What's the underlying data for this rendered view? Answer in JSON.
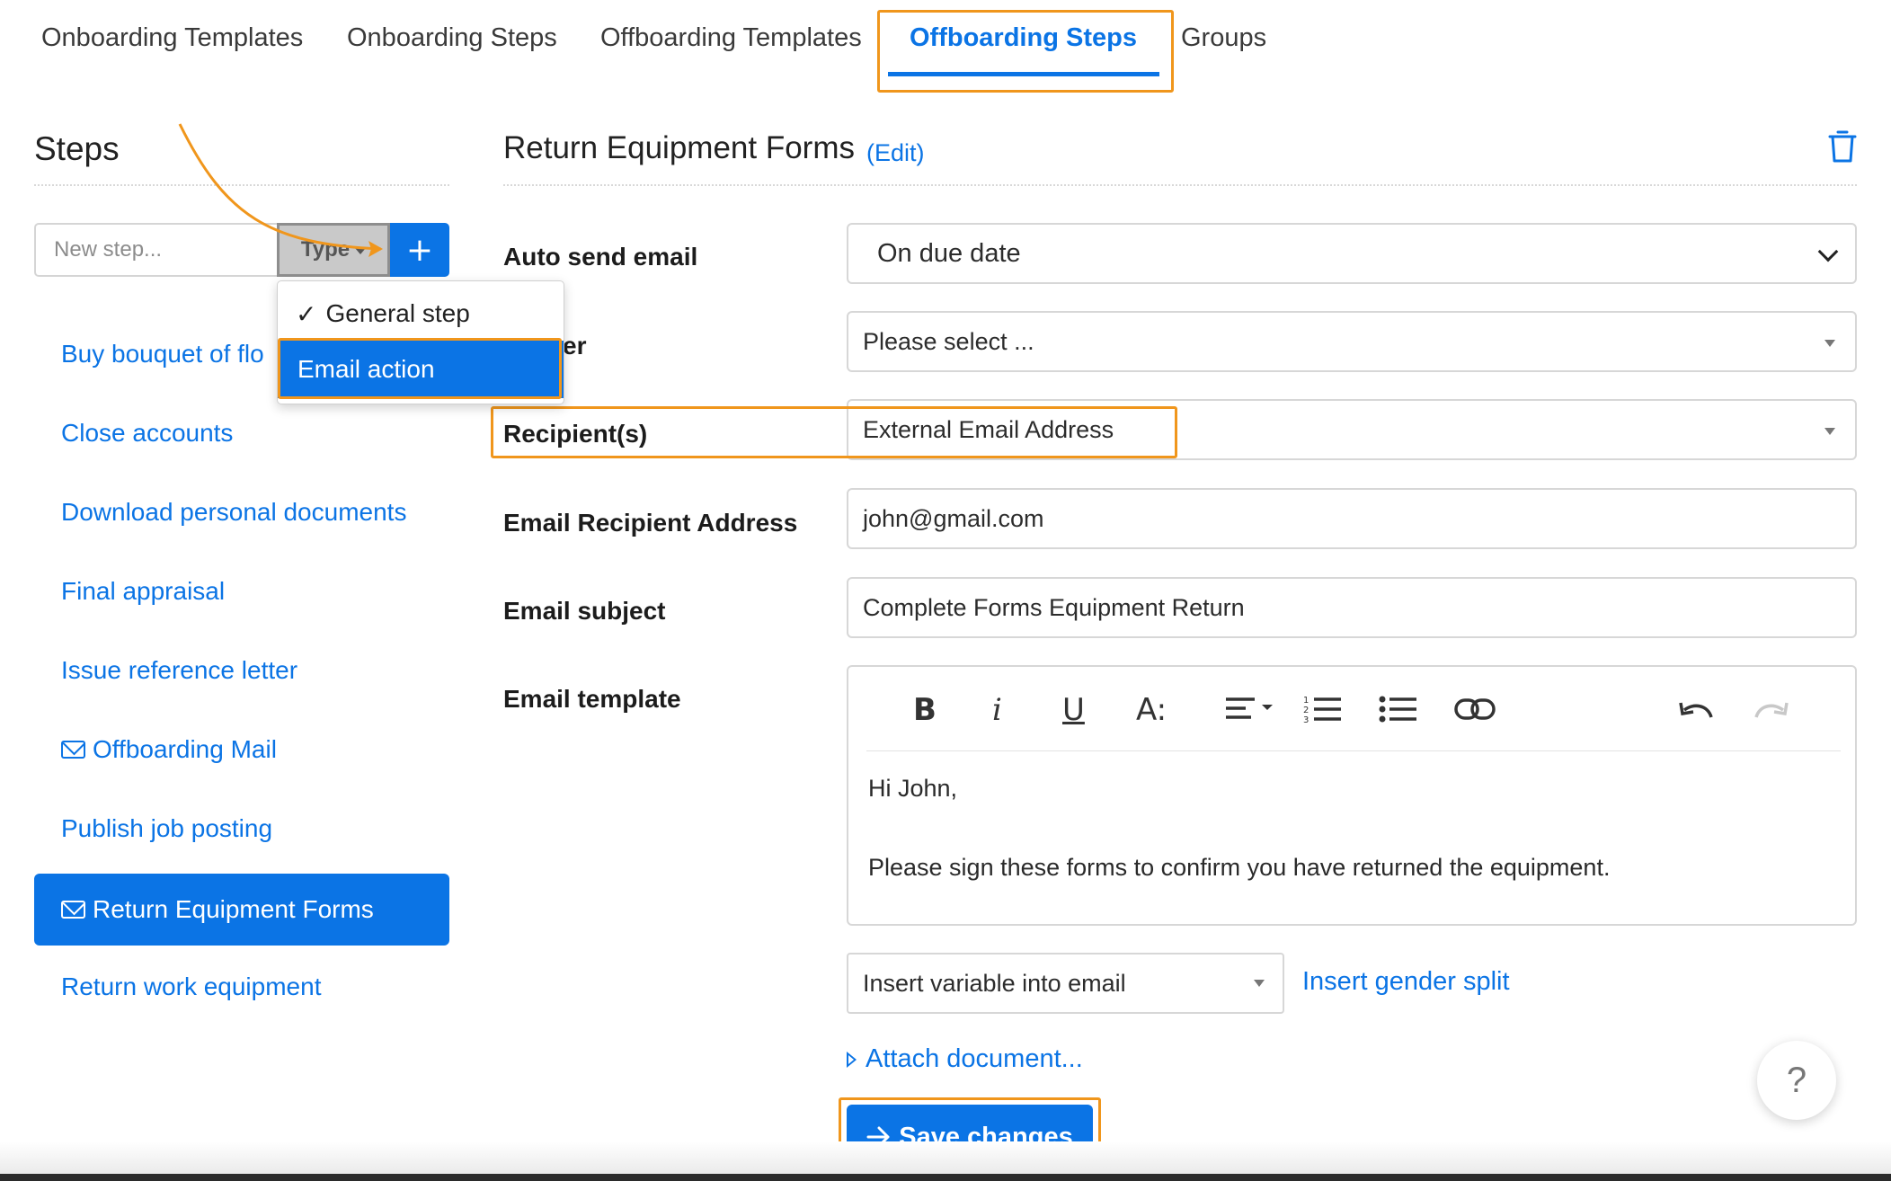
{
  "tabs": [
    {
      "label": "Onboarding Templates"
    },
    {
      "label": "Onboarding Steps"
    },
    {
      "label": "Offboarding Templates"
    },
    {
      "label": "Offboarding Steps"
    },
    {
      "label": "Groups"
    }
  ],
  "active_tab": "Offboarding Steps",
  "sidebar": {
    "title": "Steps",
    "new_step_placeholder": "New step...",
    "type_label": "Type",
    "add_label": "+",
    "type_menu": {
      "general": "General step",
      "email": "Email action",
      "selected": "General step"
    },
    "items": [
      {
        "label": "Buy bouquet of flo"
      },
      {
        "label": "Close accounts"
      },
      {
        "label": "Download personal documents"
      },
      {
        "label": "Final appraisal"
      },
      {
        "label": "Issue reference letter"
      },
      {
        "label": "Offboarding Mail",
        "icon": "envelope-icon"
      },
      {
        "label": "Publish job posting"
      },
      {
        "label": "Return Equipment Forms",
        "icon": "envelope-icon",
        "active": true
      },
      {
        "label": "Return work equipment"
      }
    ]
  },
  "main": {
    "title": "Return Equipment Forms",
    "edit_label": "(Edit)",
    "fields": {
      "auto_send": {
        "label": "Auto send email",
        "value": "On due date"
      },
      "sender": {
        "label_partial": "er",
        "value": "Please select ..."
      },
      "recipients": {
        "label": "Recipient(s)",
        "value": "External Email Address"
      },
      "recipient_address": {
        "label": "Email Recipient Address",
        "value": "john@gmail.com"
      },
      "subject": {
        "label": "Email subject",
        "value": "Complete Forms Equipment Return"
      },
      "template": {
        "label": "Email template"
      }
    },
    "editor": {
      "toolbar": [
        "bold-icon",
        "italic-icon",
        "underline-icon",
        "text-size-icon",
        "align-icon",
        "ordered-list-icon",
        "bullet-list-icon",
        "link-icon",
        "undo-icon",
        "redo-icon"
      ],
      "line1": "Hi John,",
      "line2": "Please sign these forms to confirm you have returned the equipment."
    },
    "insert_variable": "Insert variable into email",
    "insert_gender": "Insert gender split",
    "attach": "Attach document...",
    "save": "Save changes",
    "help": "?"
  },
  "colors": {
    "accent": "#0b74e5",
    "highlight": "#f0961c"
  }
}
